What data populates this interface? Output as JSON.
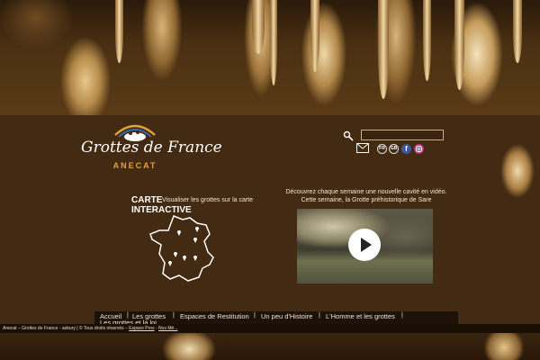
{
  "logo": {
    "title": "Grottes de France",
    "subtitle": "ANECAT"
  },
  "search": {
    "placeholder": ""
  },
  "social": {
    "fr": "FR",
    "gb": "GB",
    "facebook": "f"
  },
  "carte": {
    "title_line1": "CARTE",
    "title_line2": "INTERACTIVE",
    "description": "Visualiser les grottes sur la carte"
  },
  "video": {
    "text_line1": "Découvrez chaque semaine une nouvelle cavité en vidéo.",
    "text_line2": "Cette semaine, la Grotte préhistorique de Sare"
  },
  "nav": {
    "items": [
      "Accueil",
      "Les grottes",
      "Espaces de Restitution",
      "Un peu d'Histoire",
      "L'Homme et les grottes",
      "Les grottes et la loi"
    ]
  },
  "footer": {
    "text": "Anecat – Grottes de France - asbury | © Tous droits réservés –",
    "link1": "Espace Pros",
    "sep": " - ",
    "link2": "Nos Mé..."
  },
  "colors": {
    "panel": "#432a12",
    "accent": "#e2a23c",
    "facebook": "#3b5998",
    "instagram": "#c13584"
  }
}
